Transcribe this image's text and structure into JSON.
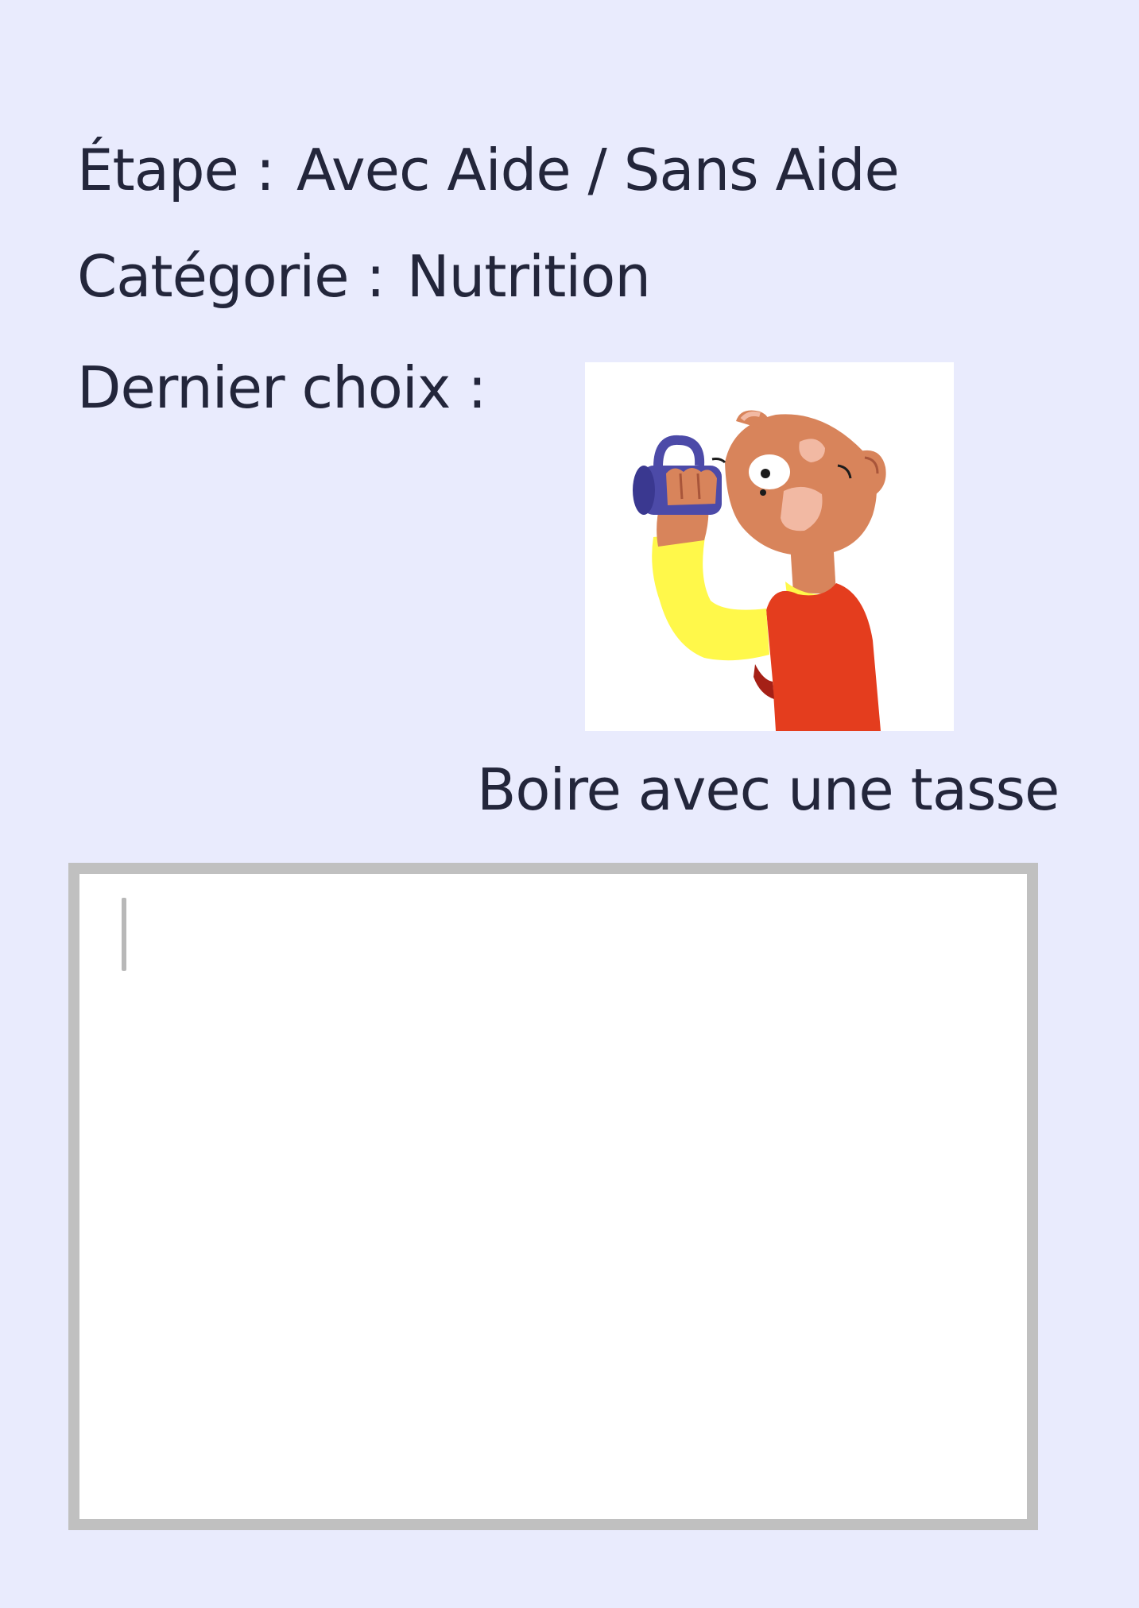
{
  "header": {
    "etape_label": "Étape :",
    "etape_value": "Avec Aide / Sans Aide",
    "categorie_label": "Catégorie :",
    "categorie_value": "Nutrition",
    "dernier_choix_label": "Dernier choix :"
  },
  "pictogram": {
    "icon": "child-drinking-from-cup-icon",
    "caption": "Boire avec une tasse"
  },
  "notes": {
    "value": "",
    "placeholder": ""
  },
  "colors": {
    "background": "#e9ebfd",
    "text": "#23263b",
    "notes_border": "#c0c0c0",
    "cup": "#4c4aa8",
    "sleeve": "#fff84a",
    "shirt": "#e43d1e",
    "skin": "#d8845b"
  }
}
